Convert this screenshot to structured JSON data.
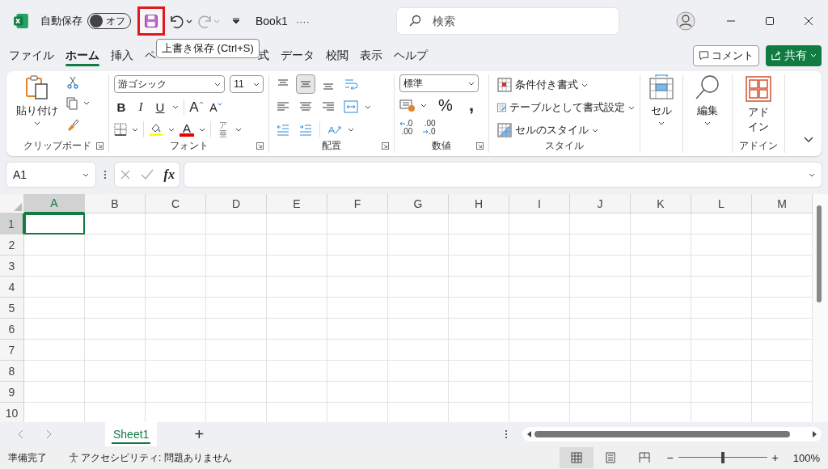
{
  "title_bar": {
    "autosave_label": "自動保存",
    "autosave": {
      "on": false,
      "label": "オフ"
    },
    "save_highlighted": true,
    "document": "Book1",
    "document_menu": "····",
    "search_placeholder": "検索"
  },
  "tooltip": "上書き保存 (Ctrl+S)",
  "tabs": [
    {
      "label": "ファイル",
      "selected": false
    },
    {
      "label": "ホーム",
      "selected": true
    },
    {
      "label": "挿入",
      "selected": false
    },
    {
      "label": "ペ",
      "selected": false
    },
    {
      "label": "式",
      "selected": false
    },
    {
      "label": "データ",
      "selected": false
    },
    {
      "label": "校閲",
      "selected": false
    },
    {
      "label": "表示",
      "selected": false
    },
    {
      "label": "ヘルプ",
      "selected": false
    }
  ],
  "comment_button": "コメント",
  "share_button": "共有",
  "ribbon": {
    "clipboard": {
      "paste": "貼り付け",
      "label": "クリップボード"
    },
    "font": {
      "name": "游ゴシック",
      "size": "11",
      "bold": "B",
      "italic": "I",
      "underline": "U",
      "grow": "A",
      "shrink": "A",
      "font_color": "A",
      "phonetic_top": "ア",
      "phonetic_bottom": "亜",
      "label": "フォント"
    },
    "alignment": {
      "rows": [
        [
          {
            "kind": "top",
            "selected": false
          },
          {
            "kind": "middle",
            "selected": true
          },
          {
            "kind": "bottom",
            "selected": false
          },
          {
            "kind": "wrap",
            "selected": false
          }
        ],
        [
          {
            "kind": "left",
            "selected": false
          },
          {
            "kind": "center",
            "selected": false
          },
          {
            "kind": "right",
            "selected": false
          },
          {
            "kind": "merge",
            "selected": false
          }
        ],
        [
          {
            "kind": "outdent",
            "selected": false
          },
          {
            "kind": "indent",
            "selected": false
          },
          {
            "kind": "orientation",
            "selected": false
          }
        ]
      ],
      "label": "配置"
    },
    "number": {
      "format": "標準",
      "percent": "%",
      "comma": ",",
      "decimals": [
        {
          "kind": "increase",
          "top": ".0",
          "bottom": ".00"
        },
        {
          "kind": "decrease",
          "top": ".00",
          "bottom": ".0"
        }
      ],
      "label": "数値"
    },
    "styles": {
      "items": [
        {
          "kind": "conditional",
          "label": "条件付き書式"
        },
        {
          "kind": "table",
          "label": "テーブルとして書式設定"
        },
        {
          "kind": "cell",
          "label": "セルのスタイル"
        }
      ],
      "label": "スタイル"
    },
    "cells": "セル",
    "editing": "編集",
    "addin": {
      "button": "アドイン",
      "label": "アドイン"
    }
  },
  "formula_bar": {
    "name_box": "A1",
    "fx": "fx"
  },
  "grid": {
    "columns": [
      {
        "label": "A",
        "selected": true
      },
      {
        "label": "B",
        "selected": false
      },
      {
        "label": "C",
        "selected": false
      },
      {
        "label": "D",
        "selected": false
      },
      {
        "label": "E",
        "selected": false
      },
      {
        "label": "F",
        "selected": false
      },
      {
        "label": "G",
        "selected": false
      },
      {
        "label": "H",
        "selected": false
      },
      {
        "label": "I",
        "selected": false
      },
      {
        "label": "J",
        "selected": false
      },
      {
        "label": "K",
        "selected": false
      },
      {
        "label": "L",
        "selected": false
      },
      {
        "label": "M",
        "selected": false
      }
    ],
    "rows": [
      {
        "label": "1",
        "selected": true
      },
      {
        "label": "2",
        "selected": false
      },
      {
        "label": "3",
        "selected": false
      },
      {
        "label": "4",
        "selected": false
      },
      {
        "label": "5",
        "selected": false
      },
      {
        "label": "6",
        "selected": false
      },
      {
        "label": "7",
        "selected": false
      },
      {
        "label": "8",
        "selected": false
      },
      {
        "label": "9",
        "selected": false
      },
      {
        "label": "10",
        "selected": false
      }
    ]
  },
  "sheets": [
    {
      "label": "Sheet1",
      "selected": true
    }
  ],
  "add_sheet": "+",
  "status": {
    "ready": "準備完了",
    "accessibility": "アクセシビリティ: 問題ありません",
    "views": [
      {
        "kind": "normal",
        "selected": true
      },
      {
        "kind": "page",
        "selected": false
      },
      {
        "kind": "break",
        "selected": false
      }
    ],
    "zoom_minus": "−",
    "zoom_plus": "+",
    "zoom": {
      "level": 0.5
    },
    "zoom_percent": "100%"
  }
}
